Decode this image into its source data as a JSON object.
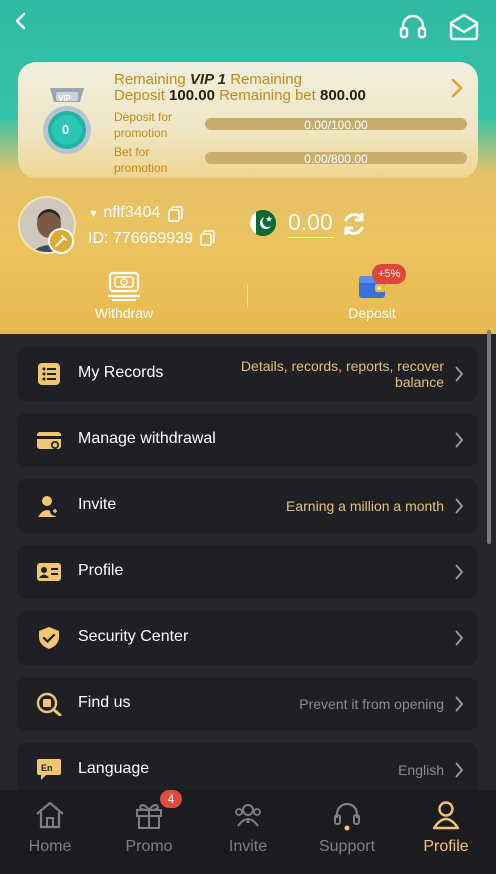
{
  "vip": {
    "prefix": "Remaining",
    "level": "VIP 1",
    "suffix": "Remaining",
    "deposit_label": "Deposit",
    "deposit_value": "100.00",
    "bet_label": "Remaining bet",
    "bet_value": "800.00",
    "badge_text": "VIP",
    "medal_number": "0",
    "deposit_promo_label": "Deposit for promotion",
    "deposit_progress": "0.00/100.00",
    "deposit_fraction": 0.0,
    "bet_promo_label": "Bet for promotion",
    "bet_progress": "0.00/800.00",
    "bet_fraction": 0.0
  },
  "user": {
    "name": "nflf3404",
    "id_text": "ID: 776669939",
    "balance": "0.00"
  },
  "actions": {
    "withdraw": "Withdraw",
    "deposit": "Deposit",
    "deposit_bonus": "+5%"
  },
  "menu": [
    {
      "label": "My Records",
      "desc": "Details, records, reports, recover balance",
      "icon": "records-icon"
    },
    {
      "label": "Manage withdrawal",
      "desc": "",
      "icon": "card-icon"
    },
    {
      "label": "Invite",
      "desc": "Earning a million a month",
      "icon": "invite-icon"
    },
    {
      "label": "Profile",
      "desc": "",
      "icon": "id-card-icon"
    },
    {
      "label": "Security Center",
      "desc": "",
      "icon": "shield-icon"
    },
    {
      "label": "Find us",
      "desc": "Prevent it from opening",
      "icon": "find-icon"
    },
    {
      "label": "Language",
      "desc": "English",
      "icon": "language-icon"
    }
  ],
  "nav": [
    {
      "label": "Home",
      "icon": "home-icon"
    },
    {
      "label": "Promo",
      "icon": "gift-icon",
      "badge": "4"
    },
    {
      "label": "Invite",
      "icon": "users-icon"
    },
    {
      "label": "Support",
      "icon": "headset-icon"
    },
    {
      "label": "Profile",
      "icon": "person-icon",
      "active": true
    }
  ],
  "colors": {
    "accent": "#f0c670",
    "teal": "#37c3a9",
    "menu_bg": "#1f2023",
    "page_bg": "#25272b"
  }
}
